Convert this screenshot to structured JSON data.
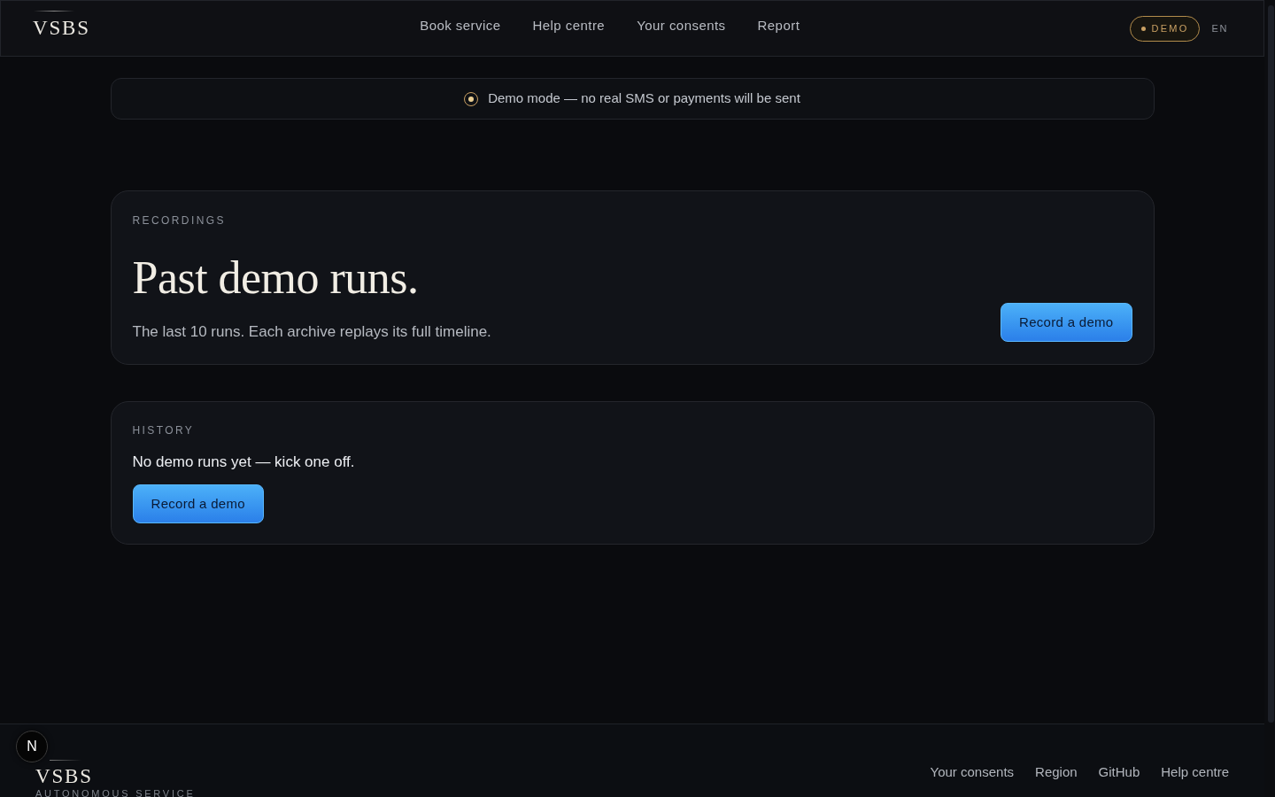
{
  "header": {
    "logo": "VSBS",
    "nav": [
      {
        "label": "Book service"
      },
      {
        "label": "Help centre"
      },
      {
        "label": "Your consents"
      },
      {
        "label": "Report"
      }
    ],
    "mode_badge": {
      "label": "DEMO"
    },
    "language": "EN"
  },
  "banner": {
    "text": "Demo mode — no real SMS or payments will be sent"
  },
  "sections": [
    {
      "kind": "hero",
      "eyebrow": "RECORDINGS",
      "title": "Past demo runs.",
      "description": "The last 10 runs. Each archive replays its full timeline.",
      "button": "Record a demo"
    },
    {
      "kind": "empty",
      "eyebrow": "HISTORY",
      "message": "No demo runs yet — kick one off.",
      "button": "Record a demo"
    }
  ],
  "footer": {
    "logo": "VSBS",
    "tagline": "AUTONOMOUS SERVICE",
    "links": [
      {
        "label": "Your consents"
      },
      {
        "label": "Region"
      },
      {
        "label": "GitHub"
      },
      {
        "label": "Help centre"
      }
    ]
  },
  "dev_indicator": {
    "label": "N"
  }
}
